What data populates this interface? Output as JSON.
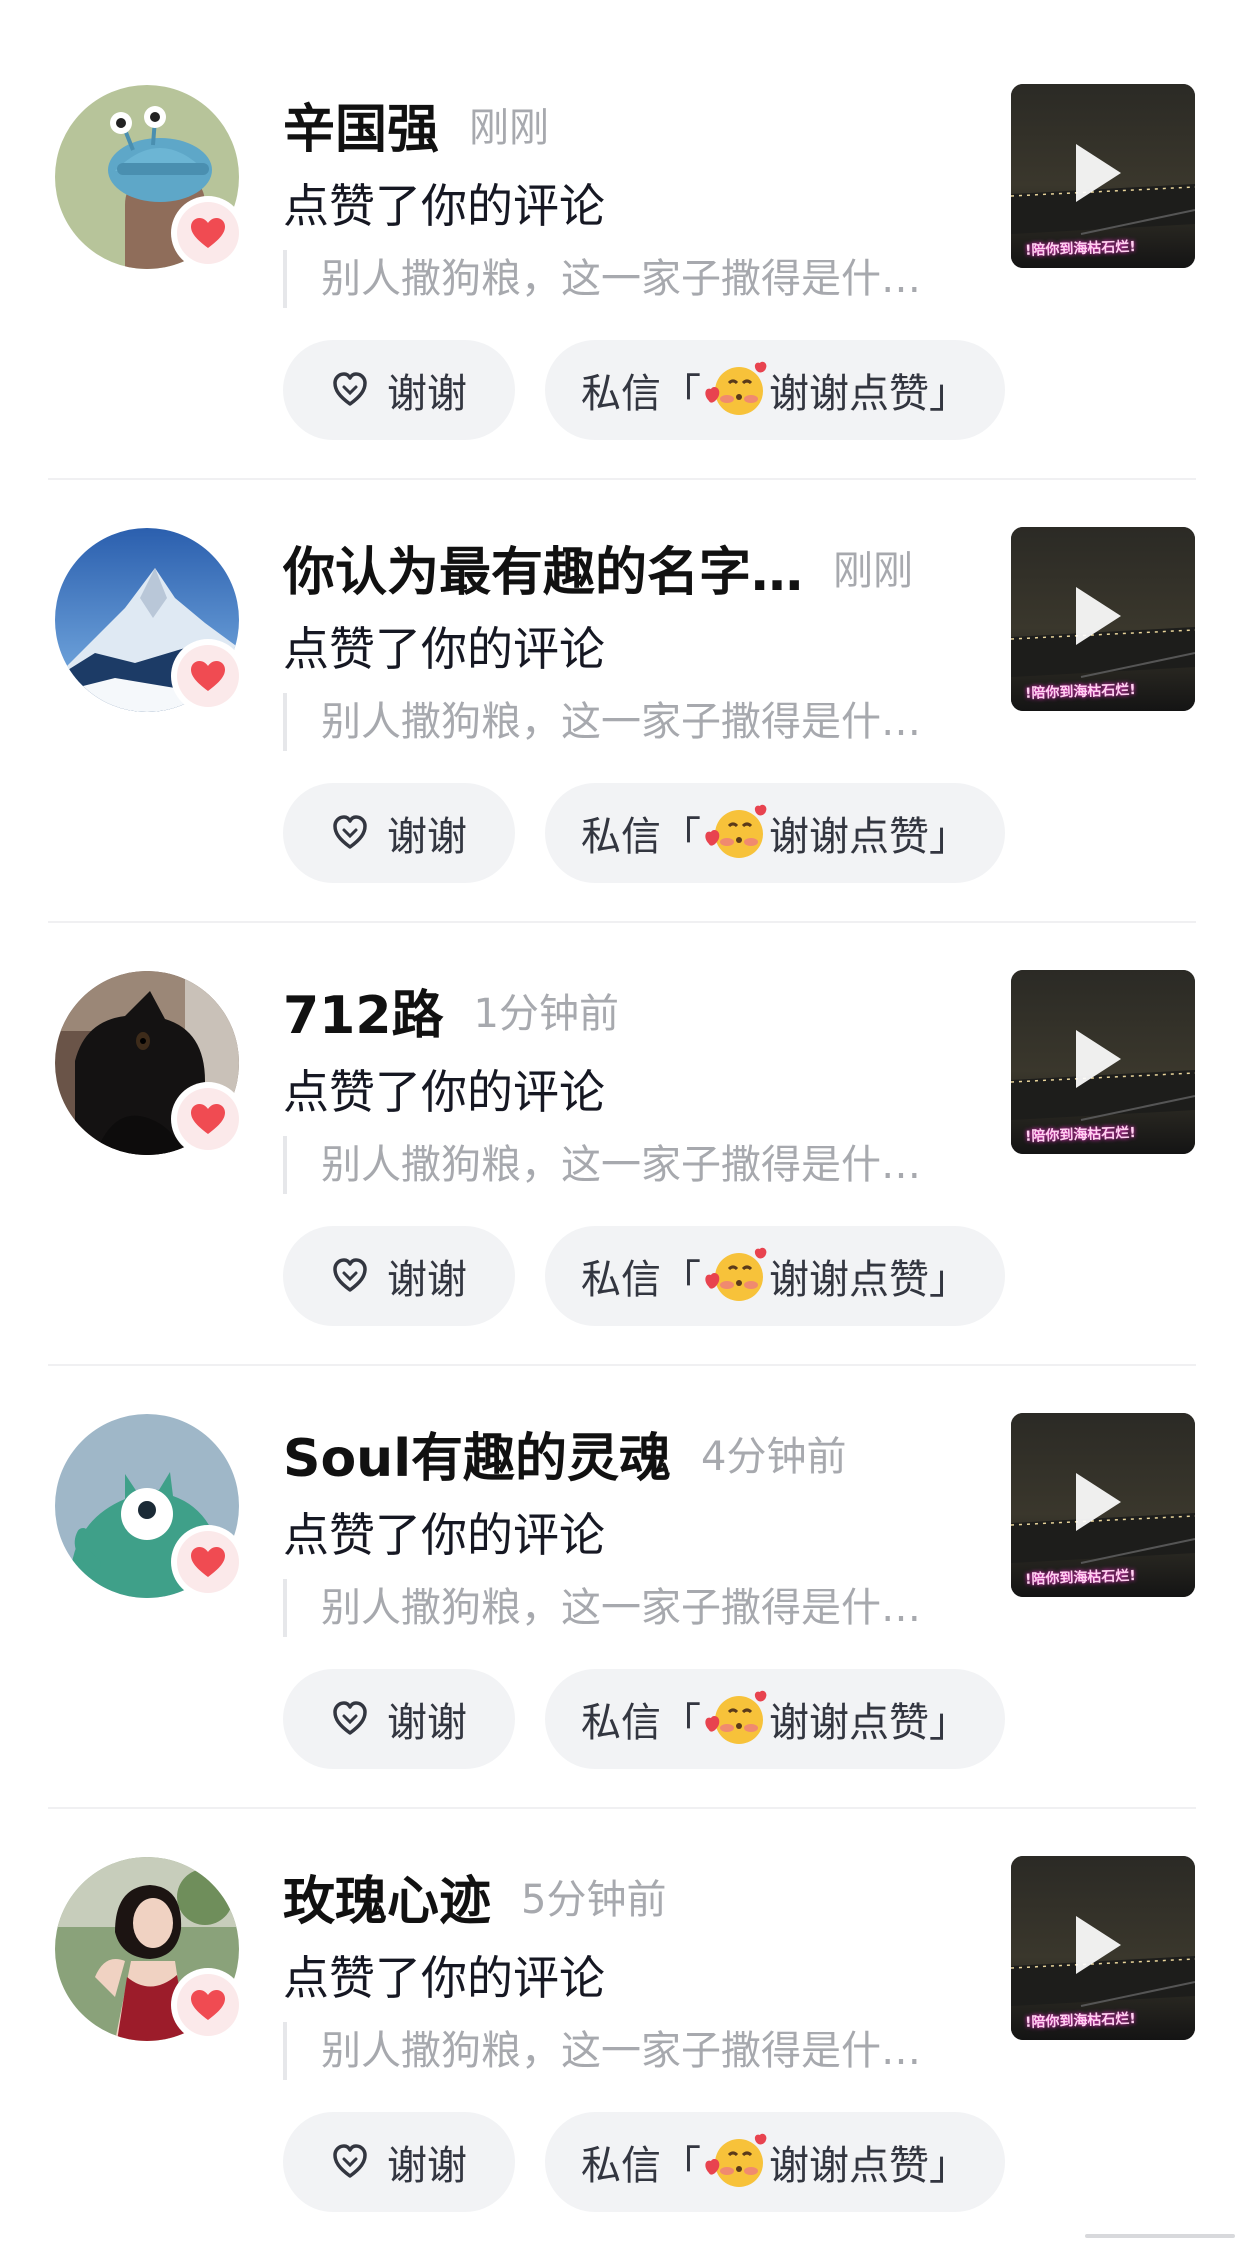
{
  "notifications": [
    {
      "user_name": "辛国强",
      "time": "刚刚",
      "action": "点赞了你的评论",
      "comment_excerpt": "别人撒狗粮，这一家子撒得是什…",
      "thanks_label": "谢谢",
      "dm_label_prefix": "私信「",
      "dm_label_text": "谢谢点赞」",
      "avatar_icon": "cartoon-snail-avatar",
      "thumbnail_caption": "!陪你到海枯石烂!"
    },
    {
      "user_name": "你认为最有趣的名字…",
      "time": "刚刚",
      "action": "点赞了你的评论",
      "comment_excerpt": "别人撒狗粮，这一家子撒得是什…",
      "thanks_label": "谢谢",
      "dm_label_prefix": "私信「",
      "dm_label_text": "谢谢点赞」",
      "avatar_icon": "snowy-mountain-avatar",
      "thumbnail_caption": "!陪你到海枯石烂!"
    },
    {
      "user_name": "712路",
      "time": "1分钟前",
      "action": "点赞了你的评论",
      "comment_excerpt": "别人撒狗粮，这一家子撒得是什…",
      "thanks_label": "谢谢",
      "dm_label_prefix": "私信「",
      "dm_label_text": "谢谢点赞」",
      "avatar_icon": "black-cat-avatar",
      "thumbnail_caption": "!陪你到海枯石烂!"
    },
    {
      "user_name": "Soul有趣的灵魂",
      "time": "4分钟前",
      "action": "点赞了你的评论",
      "comment_excerpt": "别人撒狗粮，这一家子撒得是什…",
      "thanks_label": "谢谢",
      "dm_label_prefix": "私信「",
      "dm_label_text": "谢谢点赞」",
      "avatar_icon": "green-monster-avatar",
      "thumbnail_caption": "!陪你到海枯石烂!"
    },
    {
      "user_name": "玫瑰心迹",
      "time": "5分钟前",
      "action": "点赞了你的评论",
      "comment_excerpt": "别人撒狗粮，这一家子撒得是什…",
      "thanks_label": "谢谢",
      "dm_label_prefix": "私信「",
      "dm_label_text": "谢谢点赞」",
      "avatar_icon": "woman-red-dress-avatar",
      "thumbnail_caption": "!陪你到海枯石烂!"
    }
  ],
  "colors": {
    "heart": "#f04b52",
    "badge_bg": "#fbe9ea",
    "button_bg": "#f2f3f5",
    "secondary_text": "#a7a9ae"
  }
}
